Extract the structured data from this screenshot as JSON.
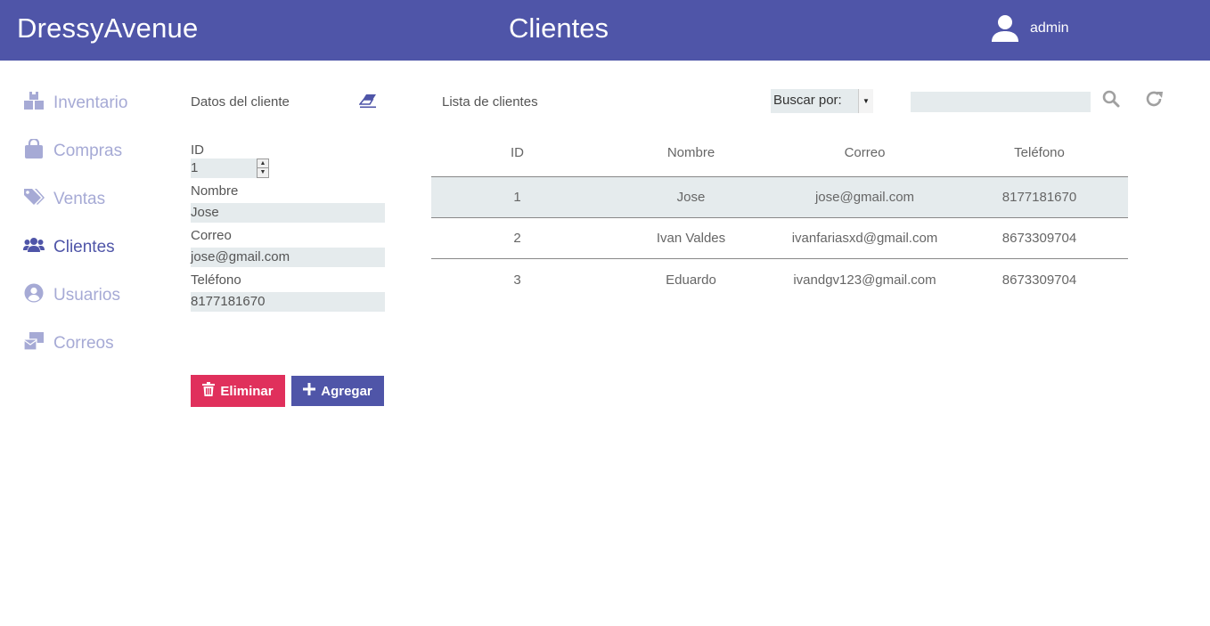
{
  "header": {
    "brand": "DressyAvenue",
    "title": "Clientes",
    "user": "admin"
  },
  "sidebar": {
    "items": [
      {
        "label": "Inventario",
        "icon": "boxes-icon",
        "active": false
      },
      {
        "label": "Compras",
        "icon": "shopping-bag-icon",
        "active": false
      },
      {
        "label": "Ventas",
        "icon": "tags-icon",
        "active": false
      },
      {
        "label": "Clientes",
        "icon": "users-icon",
        "active": true
      },
      {
        "label": "Usuarios",
        "icon": "user-circle-icon",
        "active": false
      },
      {
        "label": "Correos",
        "icon": "mail-bulk-icon",
        "active": false
      }
    ]
  },
  "form": {
    "title": "Datos del cliente",
    "id_label": "ID",
    "id_value": "1",
    "nombre_label": "Nombre",
    "nombre_value": "Jose",
    "correo_label": "Correo",
    "correo_value": "jose@gmail.com",
    "telefono_label": "Teléfono",
    "telefono_value": "8177181670",
    "delete_label": "Eliminar",
    "add_label": "Agregar"
  },
  "list": {
    "title": "Lista de clientes",
    "search_by": "Buscar por:",
    "search_value": "",
    "columns": [
      "ID",
      "Nombre",
      "Correo",
      "Teléfono"
    ],
    "rows": [
      [
        "1",
        "Jose",
        "jose@gmail.com",
        "8177181670"
      ],
      [
        "2",
        "Ivan Valdes",
        "ivanfariasxd@gmail.com",
        "8673309704"
      ],
      [
        "3",
        "Eduardo",
        "ivandgv123@gmail.com",
        "8673309704"
      ]
    ],
    "selected_row": 0
  },
  "colors": {
    "primary": "#4f55a8",
    "danger": "#e0305c",
    "sidebar_inactive": "#a6aad5",
    "field_bg": "#e5ebed"
  }
}
